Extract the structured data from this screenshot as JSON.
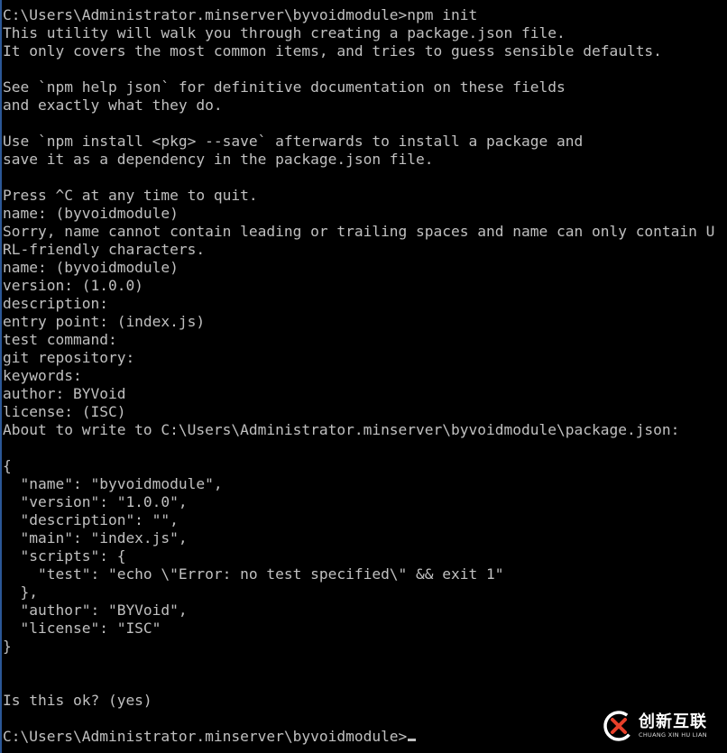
{
  "terminal": {
    "lines": [
      "C:\\Users\\Administrator.minserver\\byvoidmodule>npm init",
      "This utility will walk you through creating a package.json file.",
      "It only covers the most common items, and tries to guess sensible defaults.",
      "",
      "See `npm help json` for definitive documentation on these fields",
      "and exactly what they do.",
      "",
      "Use `npm install <pkg> --save` afterwards to install a package and",
      "save it as a dependency in the package.json file.",
      "",
      "Press ^C at any time to quit.",
      "name: (byvoidmodule)",
      "Sorry, name cannot contain leading or trailing spaces and name can only contain U",
      "RL-friendly characters.",
      "name: (byvoidmodule)",
      "version: (1.0.0)",
      "description:",
      "entry point: (index.js)",
      "test command:",
      "git repository:",
      "keywords:",
      "author: BYVoid",
      "license: (ISC)",
      "About to write to C:\\Users\\Administrator.minserver\\byvoidmodule\\package.json:",
      "",
      "{",
      "  \"name\": \"byvoidmodule\",",
      "  \"version\": \"1.0.0\",",
      "  \"description\": \"\",",
      "  \"main\": \"index.js\",",
      "  \"scripts\": {",
      "    \"test\": \"echo \\\"Error: no test specified\\\" && exit 1\"",
      "  },",
      "  \"author\": \"BYVoid\",",
      "  \"license\": \"ISC\"",
      "}",
      "",
      "",
      "Is this ok? (yes)",
      "",
      "C:\\Users\\Administrator.minserver\\byvoidmodule>"
    ],
    "cursor_line": 40,
    "text_color": "#c0c0c0",
    "background_color": "#000000"
  },
  "watermark": {
    "main_text": "创新互联",
    "sub_text": "CHUANG XIN HU LIAN",
    "icon": "chuangxin-logo-icon"
  }
}
